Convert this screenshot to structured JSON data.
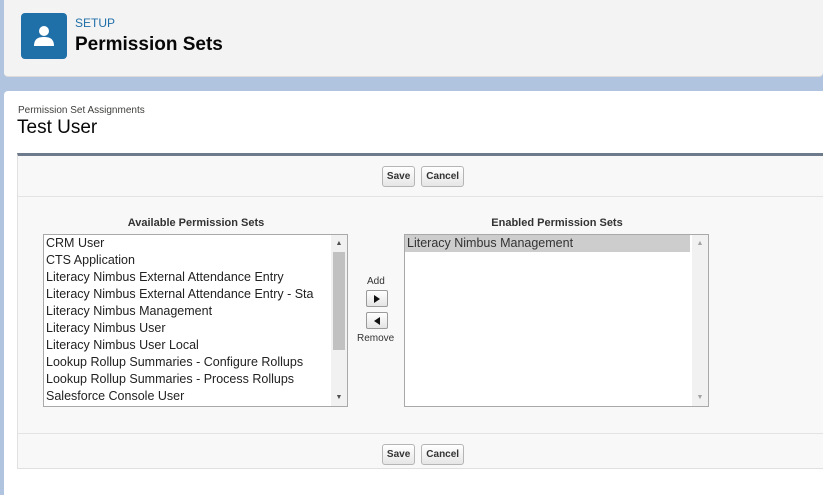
{
  "header": {
    "section_label": "SETUP",
    "page_title": "Permission Sets",
    "icon": "user-icon"
  },
  "content": {
    "breadcrumb": "Permission Set Assignments",
    "user_name": "Test User"
  },
  "toolbar": {
    "save_label": "Save",
    "cancel_label": "Cancel"
  },
  "available": {
    "heading": "Available Permission Sets",
    "items": [
      "CRM User",
      "CTS Application",
      "Literacy Nimbus External Attendance Entry",
      "Literacy Nimbus External Attendance Entry - Sta",
      "Literacy Nimbus Management",
      "Literacy Nimbus User",
      "Literacy Nimbus User Local",
      "Lookup Rollup Summaries - Configure Rollups",
      "Lookup Rollup Summaries - Process Rollups",
      "Salesforce Console User"
    ]
  },
  "mover": {
    "add_label": "Add",
    "remove_label": "Remove",
    "add_icon": "arrow-right-icon",
    "remove_icon": "arrow-left-icon"
  },
  "enabled": {
    "heading": "Enabled Permission Sets",
    "items": [
      "Literacy Nimbus Management"
    ]
  },
  "colors": {
    "brand_blue": "#1f6fa8",
    "panel_border": "#6d7b8c",
    "selected_row": "#cdcdcd"
  }
}
